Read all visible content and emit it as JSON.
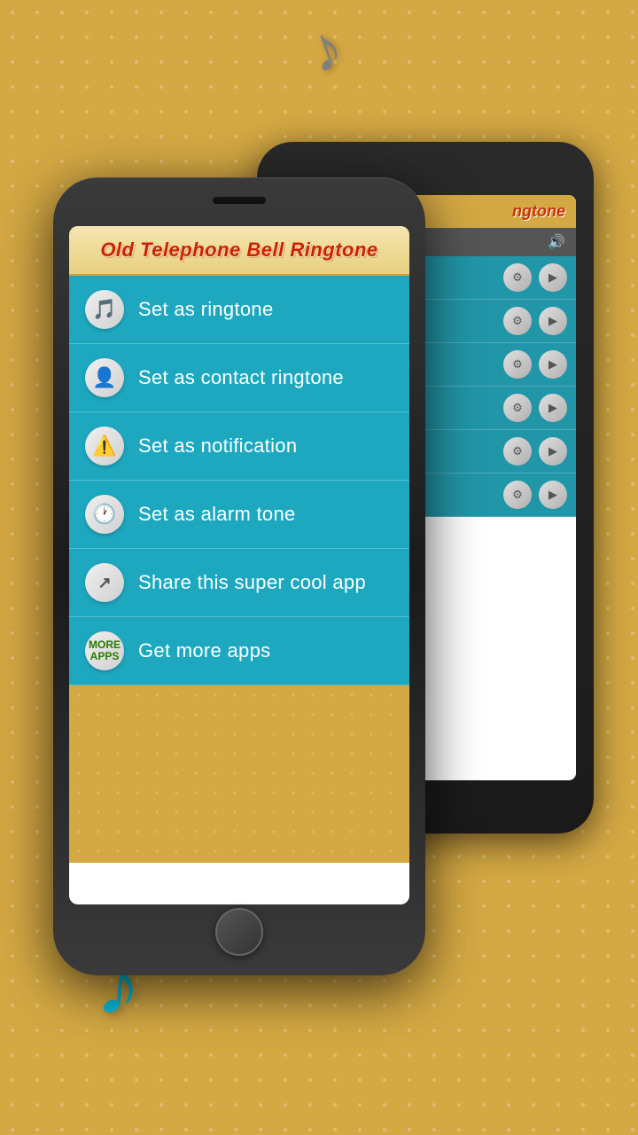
{
  "background": {
    "color": "#d4a843"
  },
  "app": {
    "title": "Old Telephone Bell Ringtone",
    "menu_items": [
      {
        "id": "ringtone",
        "label": "Set as ringtone",
        "icon": "🎵",
        "icon_name": "music-note-icon"
      },
      {
        "id": "contact-ringtone",
        "label": "Set as contact ringtone",
        "icon": "👤",
        "icon_name": "contact-icon"
      },
      {
        "id": "notification",
        "label": "Set as notification",
        "icon": "⚠️",
        "icon_name": "notification-icon"
      },
      {
        "id": "alarm",
        "label": "Set as alarm tone",
        "icon": "🕐",
        "icon_name": "alarm-icon"
      },
      {
        "id": "share",
        "label": "Share this super cool app",
        "icon": "↗",
        "icon_name": "share-icon"
      },
      {
        "id": "more-apps",
        "label": "Get more apps",
        "icon": "📱",
        "icon_name": "more-apps-icon"
      }
    ]
  },
  "back_phone": {
    "title": "ngtone",
    "rows": 6
  },
  "notes": {
    "top_note_char": "♪",
    "music_note_char": "♫"
  }
}
